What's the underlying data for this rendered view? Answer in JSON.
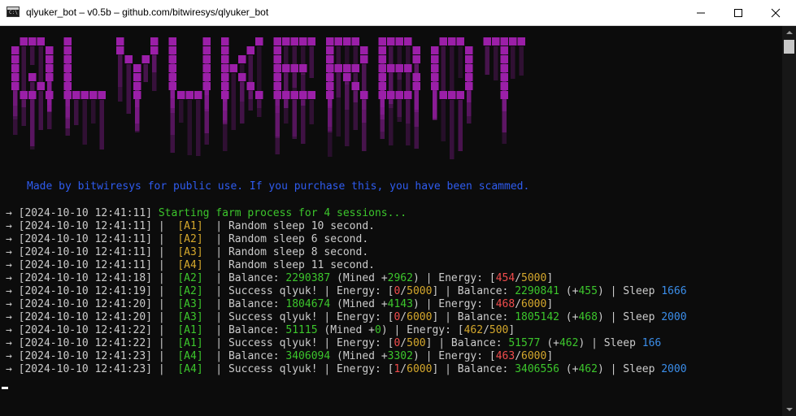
{
  "window": {
    "title": "qlyuker_bot – v0.5b – github.com/bitwiresys/qlyuker_bot"
  },
  "banner_text": "QLYUKERBOT",
  "made_by": "Made by bitwiresys for public use. If you purchase this, you have been scammed.",
  "colors": {
    "green": "#3cc62c",
    "yellow": "#d4a72c",
    "red": "#f14c4c",
    "blue": "#3b8eea",
    "purple": "#9b1fa8",
    "white": "#cccccc"
  },
  "log": [
    [
      [
        "→ ",
        "w"
      ],
      [
        "[2024-10-10 12:41:11]",
        "w"
      ],
      [
        " ",
        "w"
      ],
      [
        "Starting farm process for 4 sessions...",
        "g"
      ]
    ],
    [
      [
        "→ ",
        "w"
      ],
      [
        "[2024-10-10 12:41:11]",
        "w"
      ],
      [
        " |  ",
        "w"
      ],
      [
        "[A1]",
        "y"
      ],
      [
        "  | Random sleep 10 second.",
        "w"
      ]
    ],
    [
      [
        "→ ",
        "w"
      ],
      [
        "[2024-10-10 12:41:11]",
        "w"
      ],
      [
        " |  ",
        "w"
      ],
      [
        "[A2]",
        "y"
      ],
      [
        "  | Random sleep 6 second.",
        "w"
      ]
    ],
    [
      [
        "→ ",
        "w"
      ],
      [
        "[2024-10-10 12:41:11]",
        "w"
      ],
      [
        " |  ",
        "w"
      ],
      [
        "[A3]",
        "y"
      ],
      [
        "  | Random sleep 8 second.",
        "w"
      ]
    ],
    [
      [
        "→ ",
        "w"
      ],
      [
        "[2024-10-10 12:41:11]",
        "w"
      ],
      [
        " |  ",
        "w"
      ],
      [
        "[A4]",
        "y"
      ],
      [
        "  | Random sleep 11 second.",
        "w"
      ]
    ],
    [
      [
        "→ ",
        "w"
      ],
      [
        "[2024-10-10 12:41:18]",
        "w"
      ],
      [
        " |  ",
        "w"
      ],
      [
        "[A2]",
        "g"
      ],
      [
        "  | Balance: ",
        "w"
      ],
      [
        "2290387",
        "g"
      ],
      [
        " (Mined +",
        "w"
      ],
      [
        "2962",
        "g"
      ],
      [
        ") | Energy: [",
        "w"
      ],
      [
        "454",
        "r"
      ],
      [
        "/",
        "w"
      ],
      [
        "5000",
        "y"
      ],
      [
        "]",
        "w"
      ]
    ],
    [
      [
        "→ ",
        "w"
      ],
      [
        "[2024-10-10 12:41:19]",
        "w"
      ],
      [
        " |  ",
        "w"
      ],
      [
        "[A2]",
        "g"
      ],
      [
        "  | Success qlyuk! | Energy: [",
        "w"
      ],
      [
        "0",
        "r"
      ],
      [
        "/",
        "w"
      ],
      [
        "5000",
        "y"
      ],
      [
        "] | Balance: ",
        "w"
      ],
      [
        "2290841",
        "g"
      ],
      [
        " (+",
        "w"
      ],
      [
        "455",
        "g"
      ],
      [
        ") | Sleep ",
        "w"
      ],
      [
        "1666",
        "b"
      ]
    ],
    [
      [
        "→ ",
        "w"
      ],
      [
        "[2024-10-10 12:41:20]",
        "w"
      ],
      [
        " |  ",
        "w"
      ],
      [
        "[A3]",
        "g"
      ],
      [
        "  | Balance: ",
        "w"
      ],
      [
        "1804674",
        "g"
      ],
      [
        " (Mined +",
        "w"
      ],
      [
        "4143",
        "g"
      ],
      [
        ") | Energy: [",
        "w"
      ],
      [
        "468",
        "r"
      ],
      [
        "/",
        "w"
      ],
      [
        "6000",
        "y"
      ],
      [
        "]",
        "w"
      ]
    ],
    [
      [
        "→ ",
        "w"
      ],
      [
        "[2024-10-10 12:41:20]",
        "w"
      ],
      [
        " |  ",
        "w"
      ],
      [
        "[A3]",
        "g"
      ],
      [
        "  | Success qlyuk! | Energy: [",
        "w"
      ],
      [
        "0",
        "r"
      ],
      [
        "/",
        "w"
      ],
      [
        "6000",
        "y"
      ],
      [
        "] | Balance: ",
        "w"
      ],
      [
        "1805142",
        "g"
      ],
      [
        " (+",
        "w"
      ],
      [
        "468",
        "g"
      ],
      [
        ") | Sleep ",
        "w"
      ],
      [
        "2000",
        "b"
      ]
    ],
    [
      [
        "→ ",
        "w"
      ],
      [
        "[2024-10-10 12:41:22]",
        "w"
      ],
      [
        " |  ",
        "w"
      ],
      [
        "[A1]",
        "g"
      ],
      [
        "  | Balance: ",
        "w"
      ],
      [
        "51115",
        "g"
      ],
      [
        " (Mined +",
        "w"
      ],
      [
        "0",
        "g"
      ],
      [
        ") | Energy: [",
        "w"
      ],
      [
        "462",
        "y"
      ],
      [
        "/",
        "w"
      ],
      [
        "500",
        "y"
      ],
      [
        "]",
        "w"
      ]
    ],
    [
      [
        "→ ",
        "w"
      ],
      [
        "[2024-10-10 12:41:22]",
        "w"
      ],
      [
        " |  ",
        "w"
      ],
      [
        "[A1]",
        "g"
      ],
      [
        "  | Success qlyuk! | Energy: [",
        "w"
      ],
      [
        "0",
        "r"
      ],
      [
        "/",
        "w"
      ],
      [
        "500",
        "y"
      ],
      [
        "] | Balance: ",
        "w"
      ],
      [
        "51577",
        "g"
      ],
      [
        " (+",
        "w"
      ],
      [
        "462",
        "g"
      ],
      [
        ") | Sleep ",
        "w"
      ],
      [
        "166",
        "b"
      ]
    ],
    [
      [
        "→ ",
        "w"
      ],
      [
        "[2024-10-10 12:41:23]",
        "w"
      ],
      [
        " |  ",
        "w"
      ],
      [
        "[A4]",
        "g"
      ],
      [
        "  | Balance: ",
        "w"
      ],
      [
        "3406094",
        "g"
      ],
      [
        " (Mined +",
        "w"
      ],
      [
        "3302",
        "g"
      ],
      [
        ") | Energy: [",
        "w"
      ],
      [
        "463",
        "r"
      ],
      [
        "/",
        "w"
      ],
      [
        "6000",
        "y"
      ],
      [
        "]",
        "w"
      ]
    ],
    [
      [
        "→ ",
        "w"
      ],
      [
        "[2024-10-10 12:41:23]",
        "w"
      ],
      [
        " |  ",
        "w"
      ],
      [
        "[A4]",
        "g"
      ],
      [
        "  | Success qlyuk! | Energy: [",
        "w"
      ],
      [
        "1",
        "r"
      ],
      [
        "/",
        "w"
      ],
      [
        "6000",
        "y"
      ],
      [
        "] | Balance: ",
        "w"
      ],
      [
        "3406556",
        "g"
      ],
      [
        " (+",
        "w"
      ],
      [
        "462",
        "g"
      ],
      [
        ") | Sleep ",
        "w"
      ],
      [
        "2000",
        "b"
      ]
    ]
  ]
}
